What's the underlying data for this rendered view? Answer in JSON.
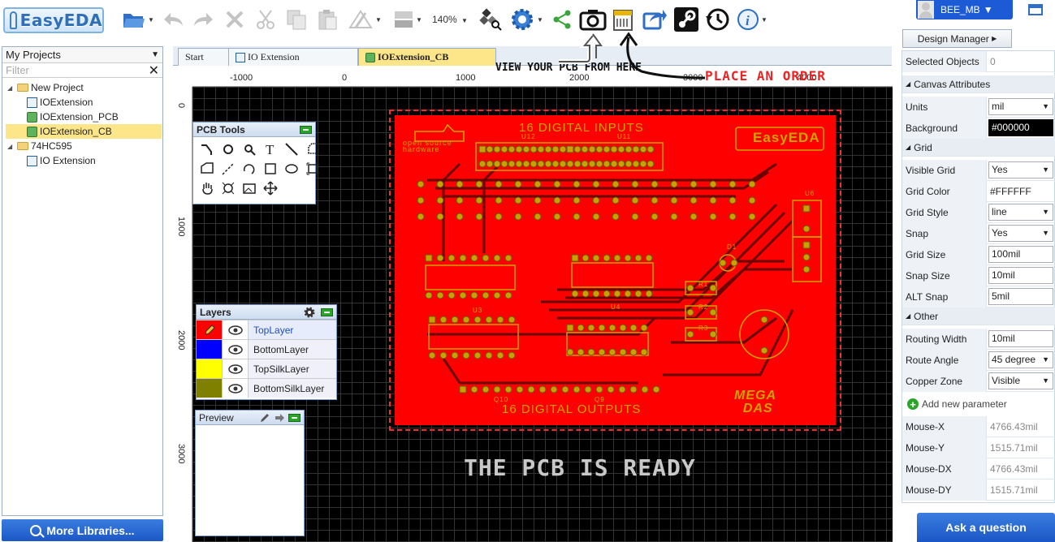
{
  "logo": {
    "text": "EasyEDA"
  },
  "toolbar": {
    "icons": [
      "open-folder-icon",
      "undo-icon",
      "redo-icon",
      "delete-icon",
      "cut-icon",
      "copy-icon",
      "paste-icon",
      "align-icon",
      "layer-icon",
      "zoom-icon",
      "cog-icon",
      "share-icon",
      "camera-icon",
      "fabrication-icon",
      "export-icon",
      "steam-icon",
      "history-icon",
      "info-icon"
    ],
    "zoom": "140%"
  },
  "user": {
    "name": "BEE_MB"
  },
  "left": {
    "project_selector": "My Projects",
    "filter_placeholder": "Filter",
    "tree": [
      {
        "label": "New Project",
        "type": "folder",
        "level": 1
      },
      {
        "label": "IOExtension",
        "type": "schematic",
        "level": 2
      },
      {
        "label": "IOExtension_PCB",
        "type": "pcb",
        "level": 2
      },
      {
        "label": "IOExtension_CB",
        "type": "pcb",
        "level": 2,
        "selected": true
      },
      {
        "label": "74HC595",
        "type": "folder",
        "level": 1
      },
      {
        "label": "IO Extension",
        "type": "schematic",
        "level": 2
      }
    ],
    "more_libraries": "More Libraries..."
  },
  "tabs": [
    {
      "label": "Start"
    },
    {
      "label": "IO Extension"
    },
    {
      "label": "IOExtension_CB",
      "active": true
    }
  ],
  "ruler": {
    "top": [
      "-1000",
      "0",
      "1000",
      "2000",
      "3000",
      "4000"
    ],
    "left": [
      "0",
      "1000",
      "2000",
      "3000"
    ]
  },
  "annotations": {
    "view": "VIEW YOUR PCB FROM HERE",
    "order": "PLACE AN ORDER",
    "ready": "THE PCB IS READY"
  },
  "board": {
    "top_text": "16 DIGITAL INPUTS",
    "bottom_text": "16 DIGITAL OUTPUTS",
    "oshw_lines": [
      "open source",
      "hardware"
    ],
    "easyeda_logo": "EasyEDA",
    "mega_lines": [
      "MEGA",
      "DAS"
    ],
    "labels": [
      "U12",
      "U11",
      "U6",
      "D1",
      "R1",
      "R2",
      "R3",
      "U3",
      "U4",
      "Q10",
      "Q9"
    ],
    "colors": {
      "board": "#ff0000",
      "silk": "#c9a400"
    }
  },
  "pcb_tools": {
    "title": "PCB Tools"
  },
  "layers": {
    "title": "Layers",
    "rows": [
      {
        "name": "TopLayer",
        "color": "#ff0000",
        "active": true
      },
      {
        "name": "BottomLayer",
        "color": "#0000ff"
      },
      {
        "name": "TopSilkLayer",
        "color": "#ffff00"
      },
      {
        "name": "BottomSilkLayer",
        "color": "#808000"
      }
    ]
  },
  "preview": {
    "title": "Preview"
  },
  "right": {
    "design_manager": "Design Manager",
    "selected_objects": {
      "label": "Selected Objects",
      "value": "0"
    },
    "canvas_section": "Canvas Attributes",
    "units": {
      "label": "Units",
      "value": "mil"
    },
    "background": {
      "label": "Background",
      "value": "#000000"
    },
    "grid_section": "Grid",
    "visible_grid": {
      "label": "Visible Grid",
      "value": "Yes"
    },
    "grid_color": {
      "label": "Grid Color",
      "value": "#FFFFFF"
    },
    "grid_style": {
      "label": "Grid Style",
      "value": "line"
    },
    "snap": {
      "label": "Snap",
      "value": "Yes"
    },
    "grid_size": {
      "label": "Grid Size",
      "value": "100mil"
    },
    "snap_size": {
      "label": "Snap Size",
      "value": "10mil"
    },
    "alt_snap": {
      "label": "ALT Snap",
      "value": "5mil"
    },
    "other_section": "Other",
    "routing_width": {
      "label": "Routing Width",
      "value": "10mil"
    },
    "route_angle": {
      "label": "Route Angle",
      "value": "45 degree"
    },
    "copper_zone": {
      "label": "Copper Zone",
      "value": "Visible"
    },
    "add_param": "Add new parameter",
    "mouse_x": {
      "label": "Mouse-X",
      "value": "4766.43mil"
    },
    "mouse_y": {
      "label": "Mouse-Y",
      "value": "1515.71mil"
    },
    "mouse_dx": {
      "label": "Mouse-DX",
      "value": "4766.43mil"
    },
    "mouse_dy": {
      "label": "Mouse-DY",
      "value": "1515.71mil"
    },
    "ask": "Ask a question"
  }
}
